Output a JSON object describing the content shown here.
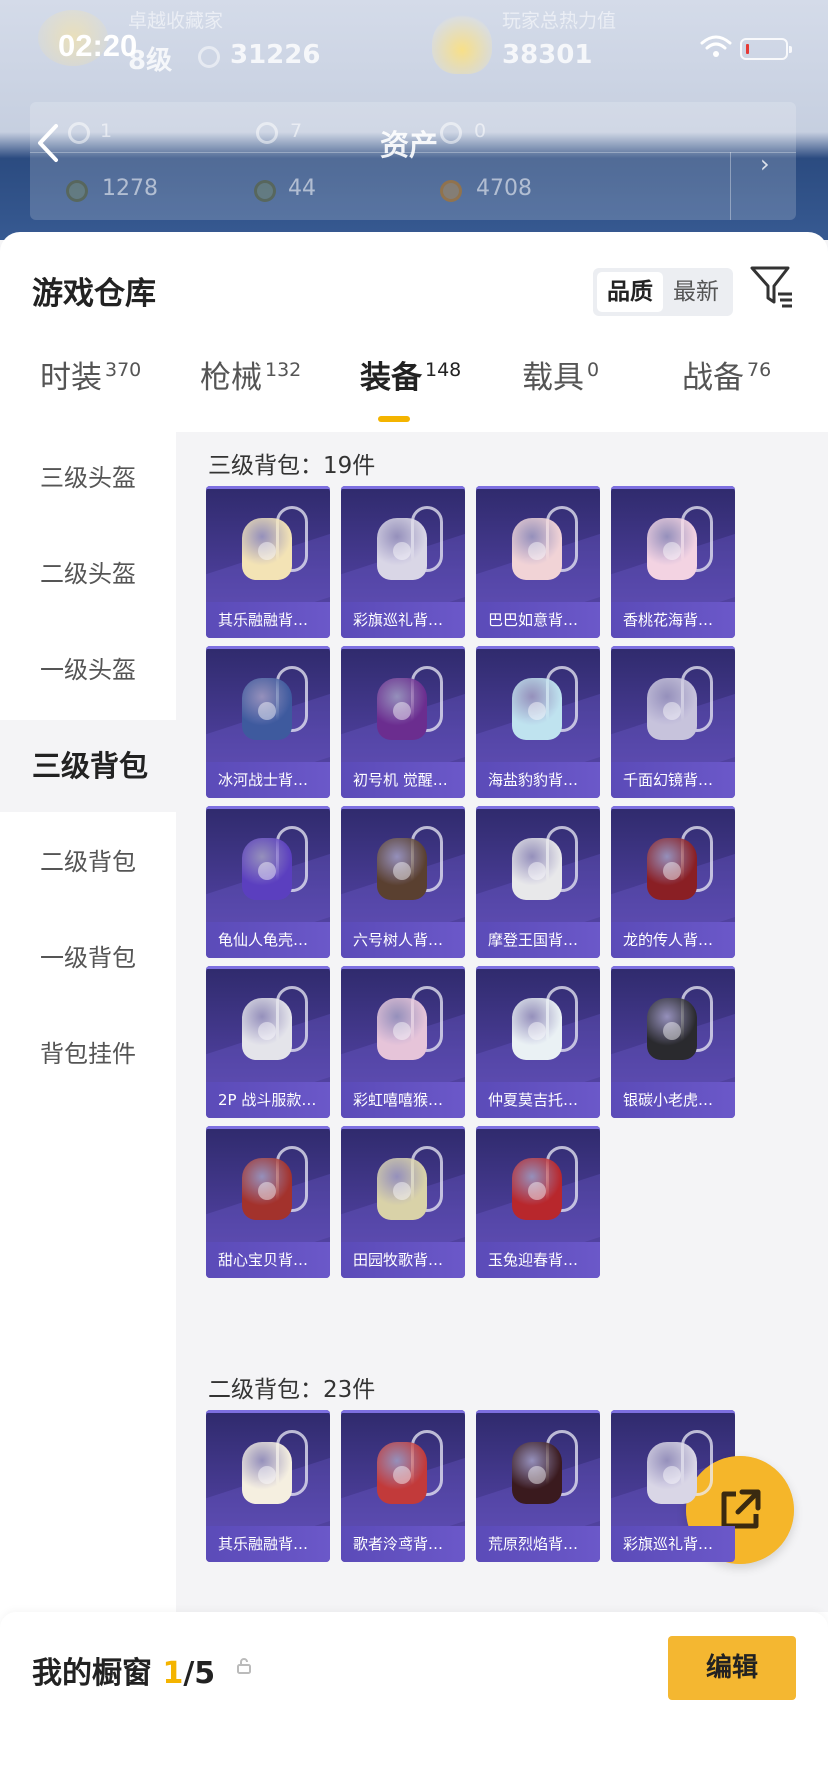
{
  "status_bar": {
    "time": "02:20"
  },
  "header_bg": {
    "rank_title": "卓越收藏家",
    "level": "8级",
    "coins": "31226",
    "power_title": "玩家总热力值",
    "power_value": "38301",
    "page_title": "资产",
    "row1": [
      "1",
      "7",
      "0"
    ],
    "row2": [
      "1278",
      "44",
      "4708"
    ]
  },
  "warehouse": {
    "title": "游戏仓库",
    "sort_options": [
      "品质",
      "最新"
    ],
    "sort_active": 0
  },
  "tabs": [
    {
      "label": "时装",
      "count": "370"
    },
    {
      "label": "枪械",
      "count": "132"
    },
    {
      "label": "装备",
      "count": "148"
    },
    {
      "label": "载具",
      "count": "0"
    },
    {
      "label": "战备",
      "count": "76"
    }
  ],
  "active_tab": 2,
  "sidebar": {
    "items": [
      "三级头盔",
      "二级头盔",
      "一级头盔",
      "三级背包",
      "二级背包",
      "一级背包",
      "背包挂件"
    ],
    "active": 3
  },
  "sections": [
    {
      "title": "三级背包：19件",
      "items": [
        {
          "label": "其乐融融背…",
          "icon": "cream-bunny-backpack-icon",
          "color": "#f3e3b5"
        },
        {
          "label": "彩旗巡礼背…",
          "icon": "lace-backpack-icon",
          "color": "#d9d6e6"
        },
        {
          "label": "巴巴如意背…",
          "icon": "pink-bunny-backpack-icon",
          "color": "#f1d3d6"
        },
        {
          "label": "香桃花海背…",
          "icon": "pink-bow-backpack-icon",
          "color": "#f3d3e2"
        },
        {
          "label": "冰河战士背…",
          "icon": "blue-armor-backpack-icon",
          "color": "#3e5a9e"
        },
        {
          "label": "初号机 觉醒…",
          "icon": "purple-mecha-backpack-icon",
          "color": "#6b2d8f"
        },
        {
          "label": "海盐豹豹背…",
          "icon": "seal-backpack-icon",
          "color": "#bfe3ef"
        },
        {
          "label": "千面幻镜背…",
          "icon": "mirror-backpack-icon",
          "color": "#c7c3dc"
        },
        {
          "label": "龟仙人龟壳…",
          "icon": "turtle-shell-backpack-icon",
          "color": "#5b3fbf"
        },
        {
          "label": "六号树人背…",
          "icon": "treehouse-backpack-icon",
          "color": "#5a4030"
        },
        {
          "label": "摩登王国背…",
          "icon": "panda-bear-backpack-icon",
          "color": "#e8e8ea"
        },
        {
          "label": "龙的传人背…",
          "icon": "red-dragon-backpack-icon",
          "color": "#8a1f24"
        },
        {
          "label": "2P 战斗服款…",
          "icon": "white-armor-backpack-icon",
          "color": "#e4e4ea"
        },
        {
          "label": "彩虹嘻嘻猴…",
          "icon": "rainbow-monkey-backpack-icon",
          "color": "#e6c4d9"
        },
        {
          "label": "仲夏莫吉托…",
          "icon": "mojito-backpack-icon",
          "color": "#eaf1f4"
        },
        {
          "label": "银碳小老虎…",
          "icon": "tiger-backpack-icon",
          "color": "#2a2a2e"
        },
        {
          "label": "甜心宝贝背…",
          "icon": "cake-backpack-icon",
          "color": "#a3322c"
        },
        {
          "label": "田园牧歌背…",
          "icon": "picnic-basket-backpack-icon",
          "color": "#d9d2a8"
        },
        {
          "label": "玉兔迎春背…",
          "icon": "red-rabbit-backpack-icon",
          "color": "#b8272c"
        }
      ]
    },
    {
      "title": "二级背包：23件",
      "items": [
        {
          "label": "其乐融融背…",
          "icon": "cream-cupcake-backpack-icon",
          "color": "#f5efe0"
        },
        {
          "label": "歌者泠鸢背…",
          "icon": "red-pouch-backpack-icon",
          "color": "#c23a3a"
        },
        {
          "label": "荒原烈焰背…",
          "icon": "black-red-backpack-icon",
          "color": "#3a1a1e"
        },
        {
          "label": "彩旗巡礼背…",
          "icon": "lace-backpack-icon",
          "color": "#d9d6e6"
        }
      ]
    }
  ],
  "bottom": {
    "window_label": "我的橱窗",
    "window_current": "1",
    "window_total": "/5",
    "edit_label": "编辑"
  }
}
